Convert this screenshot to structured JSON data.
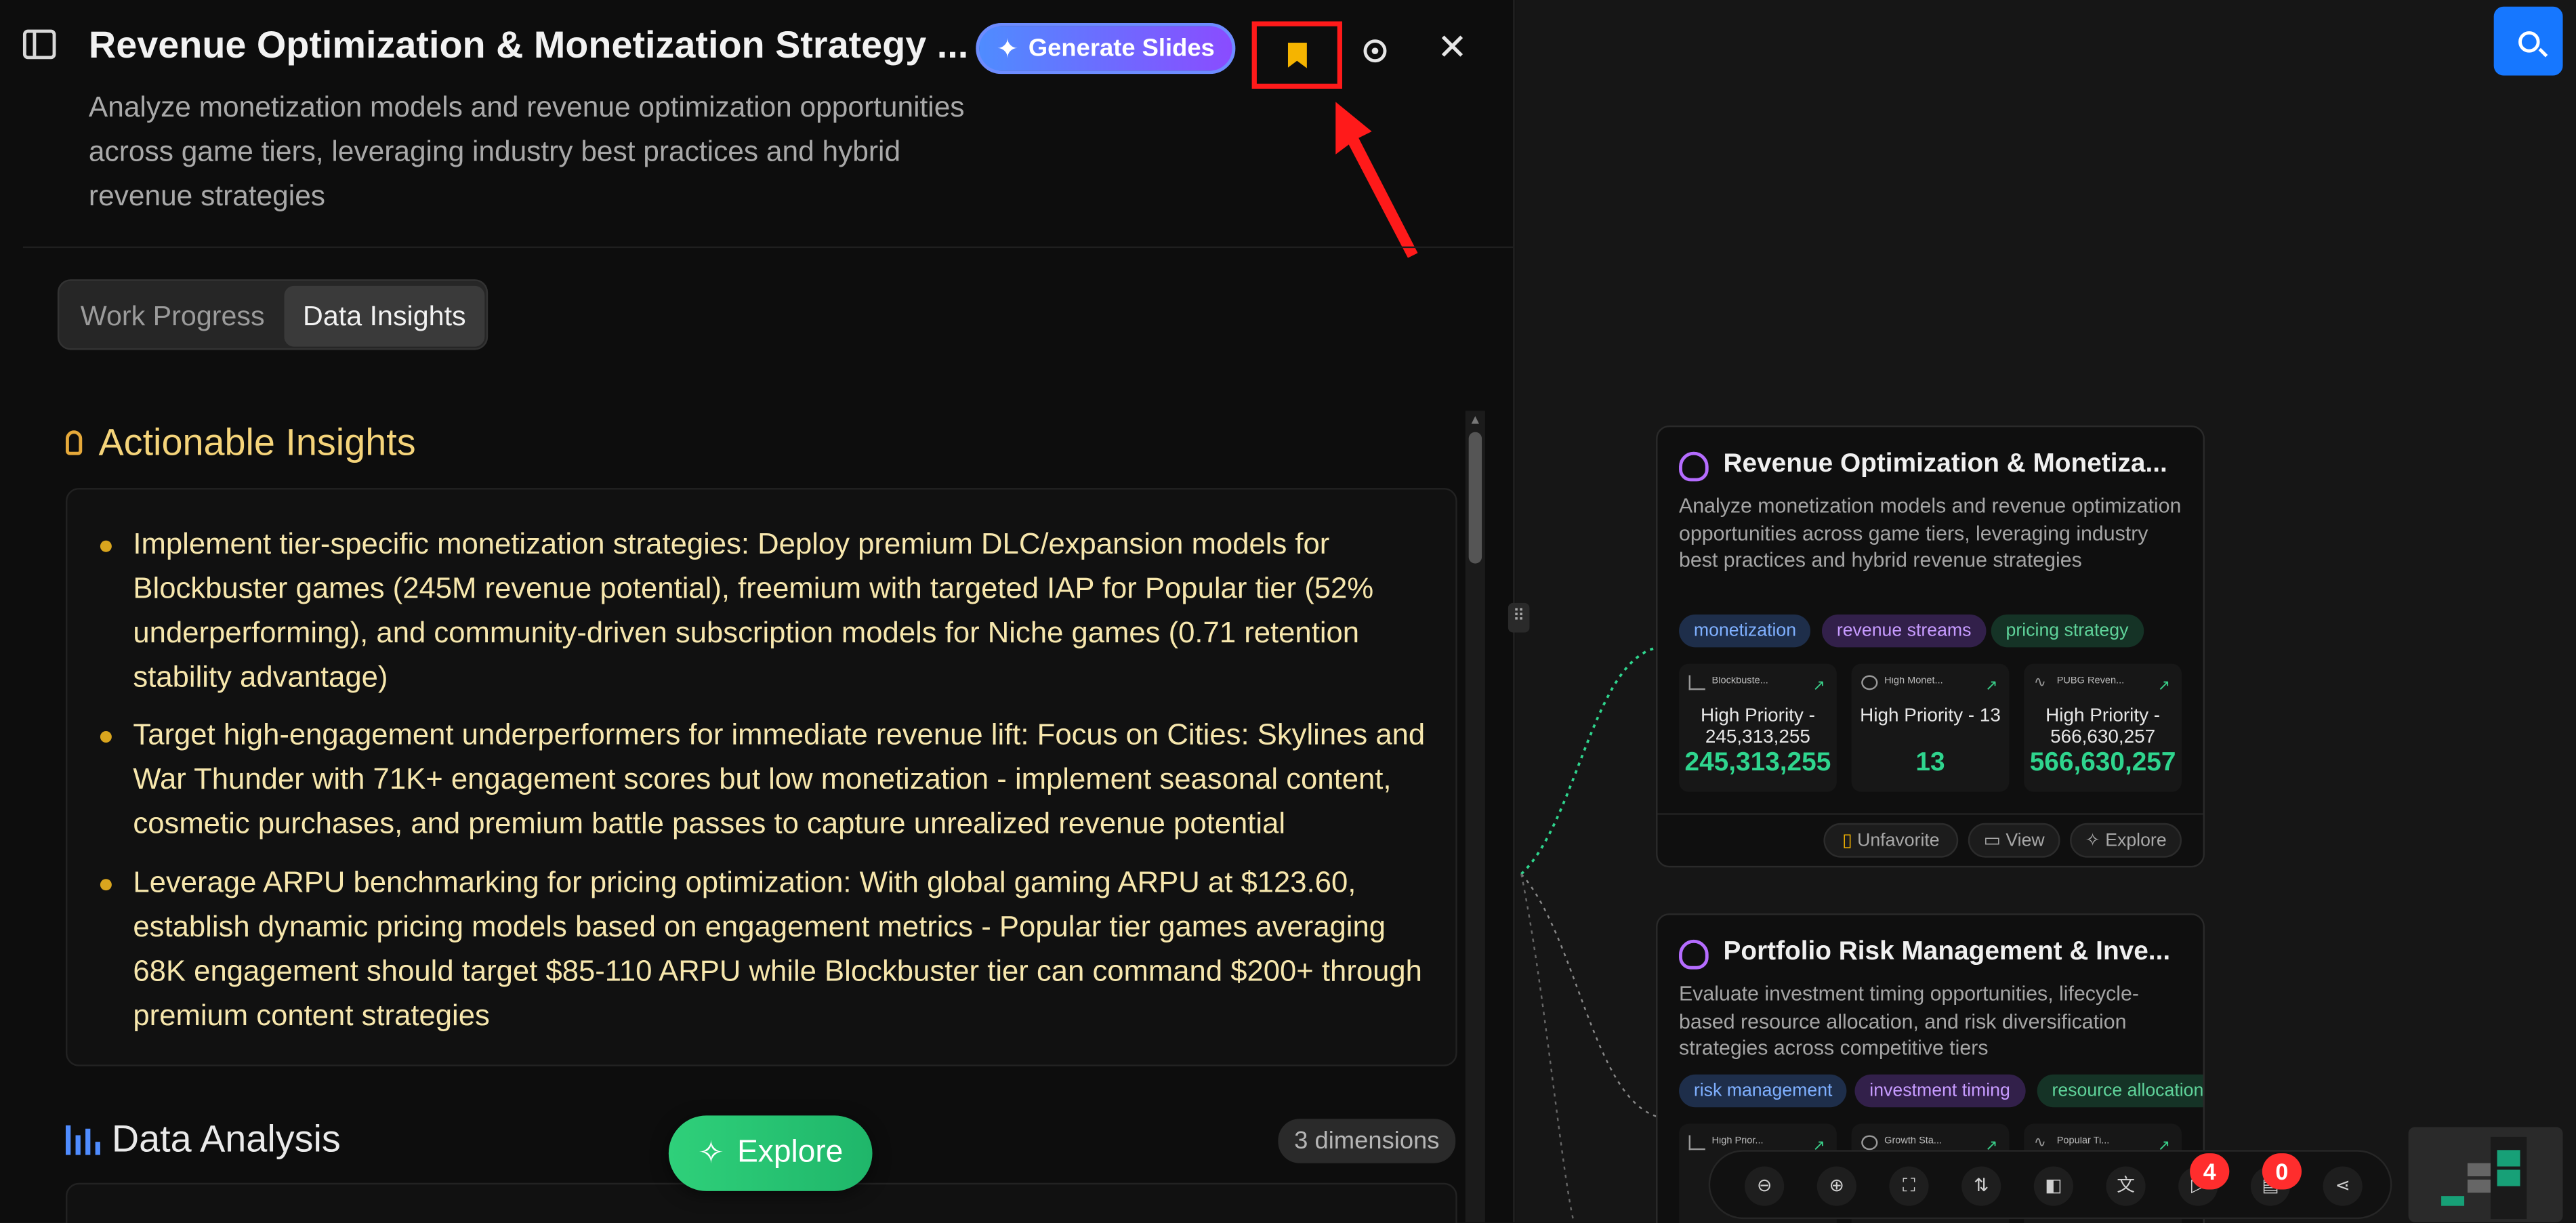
{
  "header": {
    "title": "Revenue Optimization & Monetization Strategy ...",
    "generate_label": "Generate Slides",
    "description": "Analyze monetization models and revenue optimization opportunities across game tiers, leveraging industry best practices and hybrid revenue strategies"
  },
  "tabs": [
    {
      "label": "Work Progress",
      "active": false
    },
    {
      "label": "Data Insights",
      "active": true
    }
  ],
  "insights": {
    "heading": "Actionable Insights",
    "items": [
      "Implement tier-specific monetization strategies: Deploy premium DLC/expansion models for Blockbuster games (245M revenue potential), freemium with targeted IAP for Popular tier (52% underperforming), and community-driven subscription models for Niche games (0.71 retention stability advantage)",
      "Target high-engagement underperformers for immediate revenue lift: Focus on Cities: Skylines and War Thunder with 71K+ engagement scores but low monetization - implement seasonal content, cosmetic purchases, and premium battle passes to capture unrealized revenue potential",
      "Leverage ARPU benchmarking for pricing optimization: With global gaming ARPU at $123.60, establish dynamic pricing models based on engagement metrics - Popular tier games averaging 68K engagement should target $85-110 ARPU while Blockbuster tier can command $200+ through premium content strategies"
    ]
  },
  "data_analysis": {
    "heading": "Data Analysis",
    "dimensions": "3 dimensions"
  },
  "explore_label": "Explore",
  "cards": [
    {
      "title": "Revenue Optimization & Monetiza...",
      "description": "Analyze monetization models and revenue optimization opportunities across game tiers, leveraging industry best practices and hybrid revenue strategies",
      "tags": [
        "monetization",
        "revenue streams",
        "pricing strategy"
      ],
      "stats": [
        {
          "name": "Blockbuste...",
          "label": "High Priority - 245,313,255",
          "value": "245,313,255"
        },
        {
          "name": "High Monet...",
          "label": "High Priority - 13",
          "value": "13"
        },
        {
          "name": "PUBG Reven...",
          "label": "High Priority - 566,630,257",
          "value": "566,630,257"
        }
      ],
      "actions": [
        "Unfavorite",
        "View",
        "Explore"
      ]
    },
    {
      "title": "Portfolio Risk Management & Inve...",
      "description": "Evaluate investment timing opportunities, lifecycle-based resource allocation, and risk diversification strategies across competitive tiers",
      "tags": [
        "risk management",
        "investment timing",
        "resource allocation"
      ],
      "stats": [
        {
          "name": "High Prior..."
        },
        {
          "name": "Growth Sta..."
        },
        {
          "name": "Popular Ti..."
        }
      ]
    }
  ],
  "toolbar": {
    "badge_a": "4",
    "badge_b": "0"
  },
  "colors": {
    "accent": "#1677ff",
    "explore": "#2fd07a",
    "bookmark": "#f5b400",
    "highlight": "#ff1a1a",
    "stat_value": "#2fd58e"
  }
}
